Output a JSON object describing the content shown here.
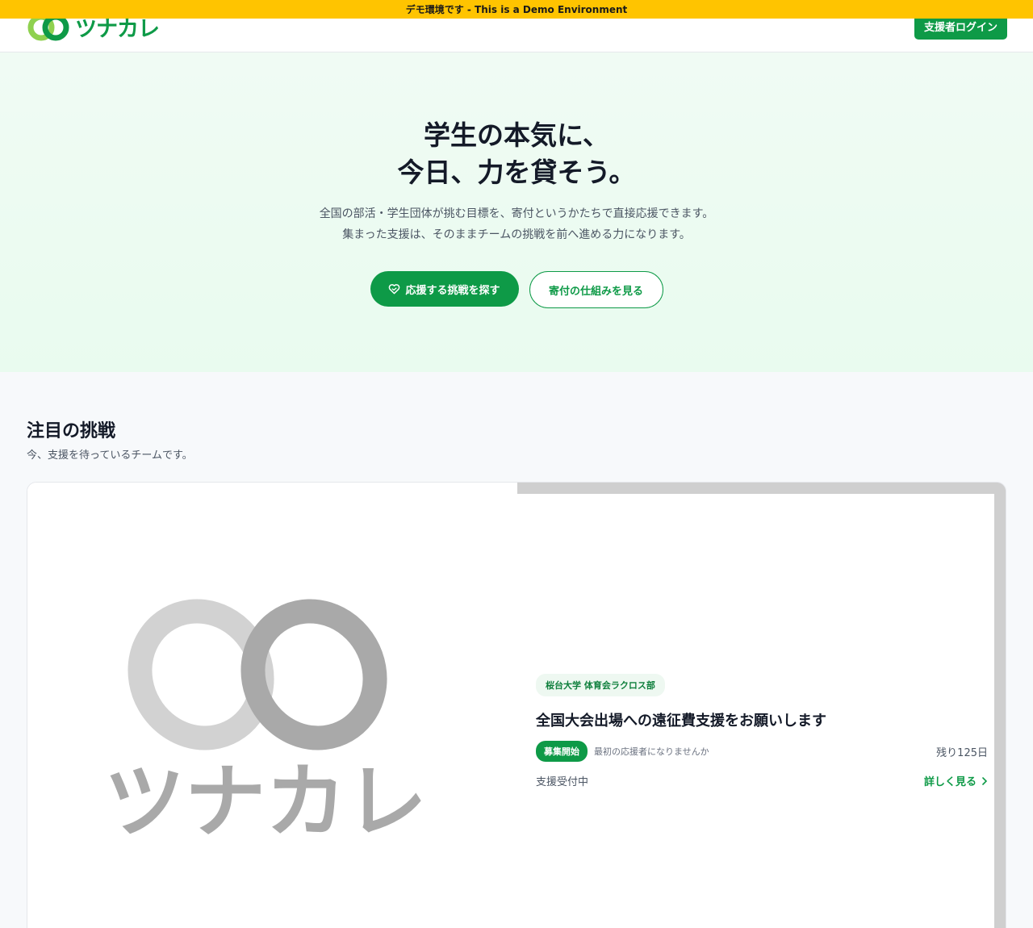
{
  "demo_banner": "デモ環境です - This is a Demo Environment",
  "header": {
    "logo_text": "ツナカレ",
    "login_label": "支援者ログイン"
  },
  "hero": {
    "title_line1": "学生の本気に、",
    "title_line2": "今日、力を貸そう。",
    "sub_line1": "全国の部活・学生団体が挑む目標を、寄付というかたちで直接応援できます。",
    "sub_line2": "集まった支援は、そのままチームの挑戦を前へ進める力になります。",
    "primary_button": "応援する挑戦を探す",
    "secondary_button": "寄付の仕組みを見る"
  },
  "featured": {
    "title": "注目の挑戦",
    "subtitle": "今、支援を待っているチームです。",
    "card": {
      "image_logo_text": "ツナカレ",
      "org": "桜台大学 体育会ラクロス部",
      "title": "全国大会出場への遠征費支援をお願いします",
      "status": "募集開始",
      "status_note": "最初の応援者になりませんか",
      "days_left": "残り125日",
      "accepting": "支援受付中",
      "detail_link": "詳しく見る"
    }
  },
  "colors": {
    "brand_green": "#0e9a47",
    "brand_light_green": "#8fd14f",
    "demo_yellow": "#ffc400"
  }
}
